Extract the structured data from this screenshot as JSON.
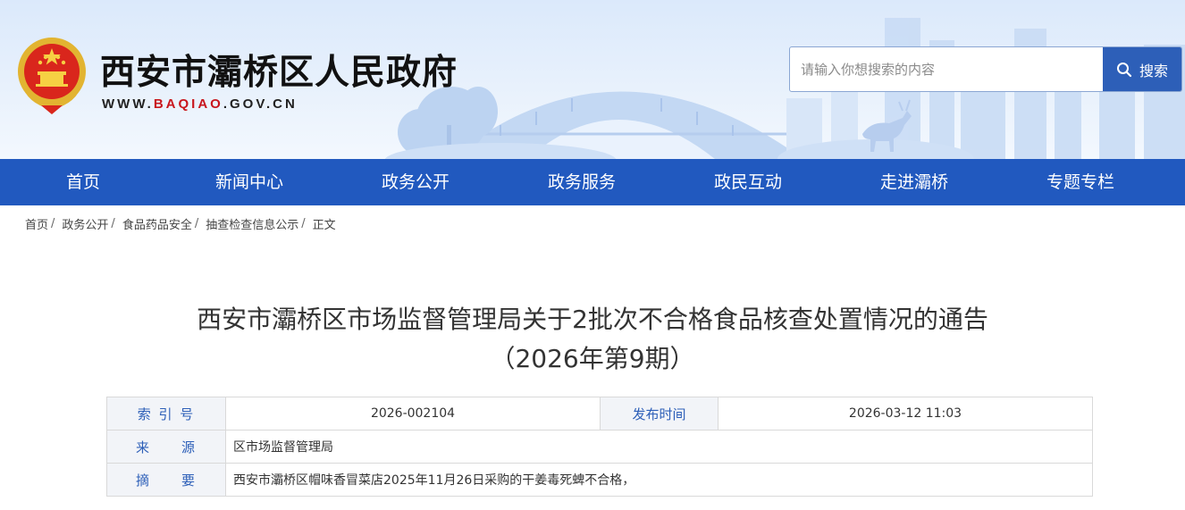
{
  "header": {
    "site_title": "西安市灞桥区人民政府",
    "domain_prefix": "WWW.",
    "domain_mid": "BAQIAO",
    "domain_suffix": ".GOV.CN",
    "search_placeholder": "请输入你想搜索的内容",
    "search_button": "搜索"
  },
  "nav": {
    "items": [
      "首页",
      "新闻中心",
      "政务公开",
      "政务服务",
      "政民互动",
      "走进灞桥",
      "专题专栏"
    ]
  },
  "breadcrumb": {
    "items": [
      "首页",
      "政务公开",
      "食品药品安全",
      "抽查检查信息公示",
      "正文"
    ],
    "separator": "/"
  },
  "article": {
    "title_line1": "西安市灞桥区市场监督管理局关于2批次不合格食品核查处置情况的通告",
    "title_line2": "（2026年第9期）"
  },
  "info": {
    "index_label": "索 引 号",
    "index_value": "2026-002104",
    "date_label": "发布时间",
    "date_value": "2026-03-12 11:03",
    "source_label": "来　　源",
    "source_value": "区市场监督管理局",
    "summary_label": "摘　　要",
    "summary_value": "西安市灞桥区帽味香冒菜店2025年11月26日采购的干姜毒死蜱不合格，"
  },
  "colors": {
    "nav_bg": "#2159bf",
    "accent_blue": "#2d5fb8",
    "domain_red": "#c8161d"
  }
}
